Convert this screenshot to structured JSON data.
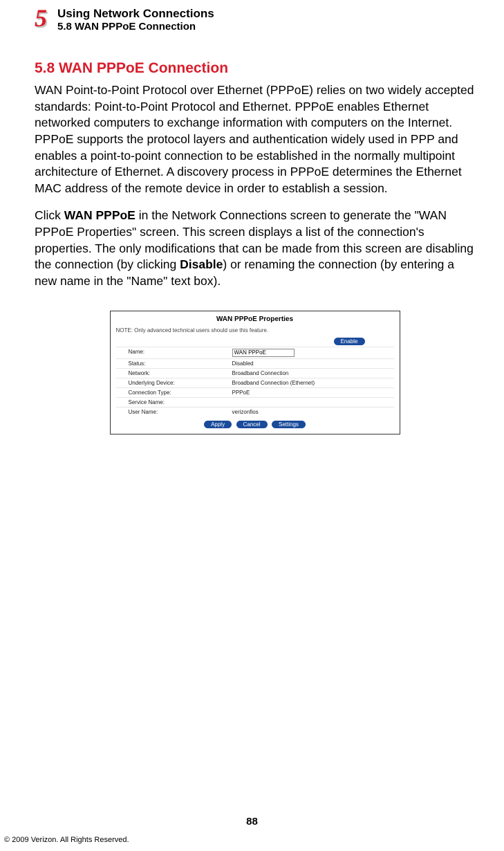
{
  "header": {
    "chapterNumber": "5",
    "chapterTitle": "Using Network Connections",
    "sectionTitleSmall": "5.8  WAN PPPoE Connection"
  },
  "section": {
    "heading": "5.8  WAN PPPoE Connection",
    "para1": "WAN Point-to-Point Protocol over Ethernet (PPPoE) relies on two widely accepted standards: Point-to-Point Protocol and Ethernet. PPPoE enables Ethernet networked computers to exchange information with computers on the Internet. PPPoE supports the protocol layers and authentication widely used in PPP and enables a point-to-point connection to be established in the normally multipoint architecture of Ethernet. A discovery process in PPPoE determines the Ethernet MAC address of the remote device in order to establish a session.",
    "para2_pre": "Click ",
    "para2_b1": "WAN PPPoE",
    "para2_mid": " in the Network Connections screen to generate the \"WAN PPPoE Properties\" screen. This screen displays a list of the connection's properties. The only modifications that can be made from this screen are disabling the connection (by clicking ",
    "para2_b2": "Disable",
    "para2_post": ") or renaming the connection (by entering a new name in the \"Name\" text box)."
  },
  "dialog": {
    "title": "WAN PPPoE Properties",
    "note": "NOTE: Only advanced technical users should use this feature.",
    "enableBtn": "Enable",
    "rows": [
      {
        "label": "Name:",
        "inputValue": "WAN PPPoE"
      },
      {
        "label": "Status:",
        "value": "Disabled"
      },
      {
        "label": "Network:",
        "value": "Broadband Connection"
      },
      {
        "label": "Underlying Device:",
        "value": "Broadband Connection (Ethernet)"
      },
      {
        "label": "Connection Type:",
        "value": "PPPoE"
      },
      {
        "label": "Service Name:",
        "value": ""
      },
      {
        "label": "User Name:",
        "value": "verizonfios"
      }
    ],
    "buttons": {
      "apply": "Apply",
      "cancel": "Cancel",
      "settings": "Settings"
    }
  },
  "footer": {
    "pageNumber": "88",
    "copyright": "© 2009 Verizon. All Rights Reserved."
  }
}
